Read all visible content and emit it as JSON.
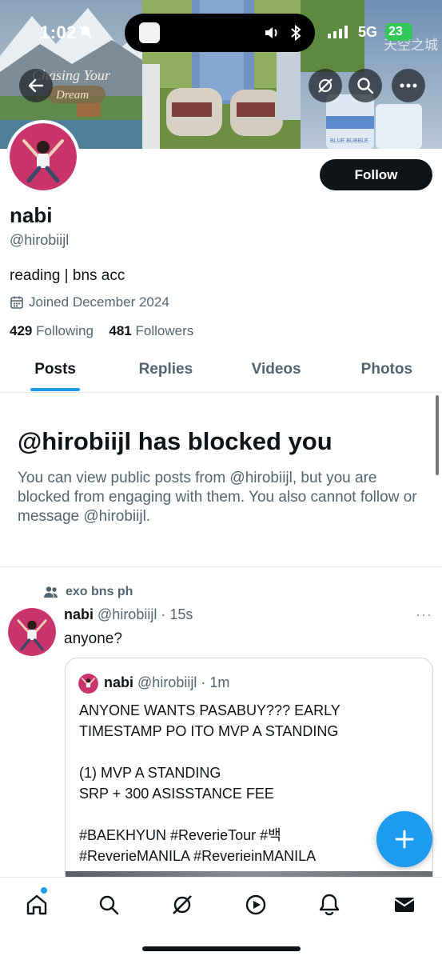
{
  "status_bar": {
    "time": "1:02",
    "network": "5G",
    "battery": "23"
  },
  "banner": {
    "left_text_top": "Chasing Your",
    "left_text_bottom": "Dream",
    "right_label": "BLUE BUBBLE",
    "watermark": "天空之城"
  },
  "header": {
    "back_icon": "back-arrow-icon",
    "action_icons": [
      "grok-icon",
      "search-icon",
      "more-icon"
    ]
  },
  "profile": {
    "display_name": "nabi",
    "handle": "@hirobiijl",
    "bio": "reading | bns acc",
    "joined": "Joined December 2024",
    "following_count": "429",
    "following_label": "Following",
    "followers_count": "481",
    "followers_label": "Followers",
    "follow_button": "Follow"
  },
  "tabs": [
    "Posts",
    "Replies",
    "Videos",
    "Photos"
  ],
  "active_tab": "Posts",
  "blocked": {
    "title": "@hirobiijl has blocked you",
    "body": "You can view public posts from @hirobiijl, but you are blocked from engaging with them. You also cannot follow or message @hirobiijl."
  },
  "post": {
    "community": "exo bns ph",
    "name": "nabi",
    "meta": "@hirobiijl · 15s",
    "text": "anyone?",
    "more": "···",
    "quote": {
      "name": "nabi",
      "meta": "@hirobiijl · 1m",
      "text": "ANYONE WANTS PASABUY??? EARLY TIMESTAMP PO ITO MVP A STANDING\n\n(1) MVP A STANDING\nSRP + 300 ASISSTANCE FEE\n\n#BAEKHYUN #ReverieTour #백\n#ReverieMANILA #ReverieinMANILA"
    }
  },
  "fab": {
    "icon": "plus-icon"
  },
  "bottom_nav": [
    "home-icon",
    "search-icon",
    "grok-icon",
    "video-icon",
    "notifications-icon",
    "messages-icon"
  ],
  "colors": {
    "accent": "#1d9bf0",
    "text": "#0f1419",
    "secondary": "#536471",
    "border": "#e6e9eb"
  }
}
